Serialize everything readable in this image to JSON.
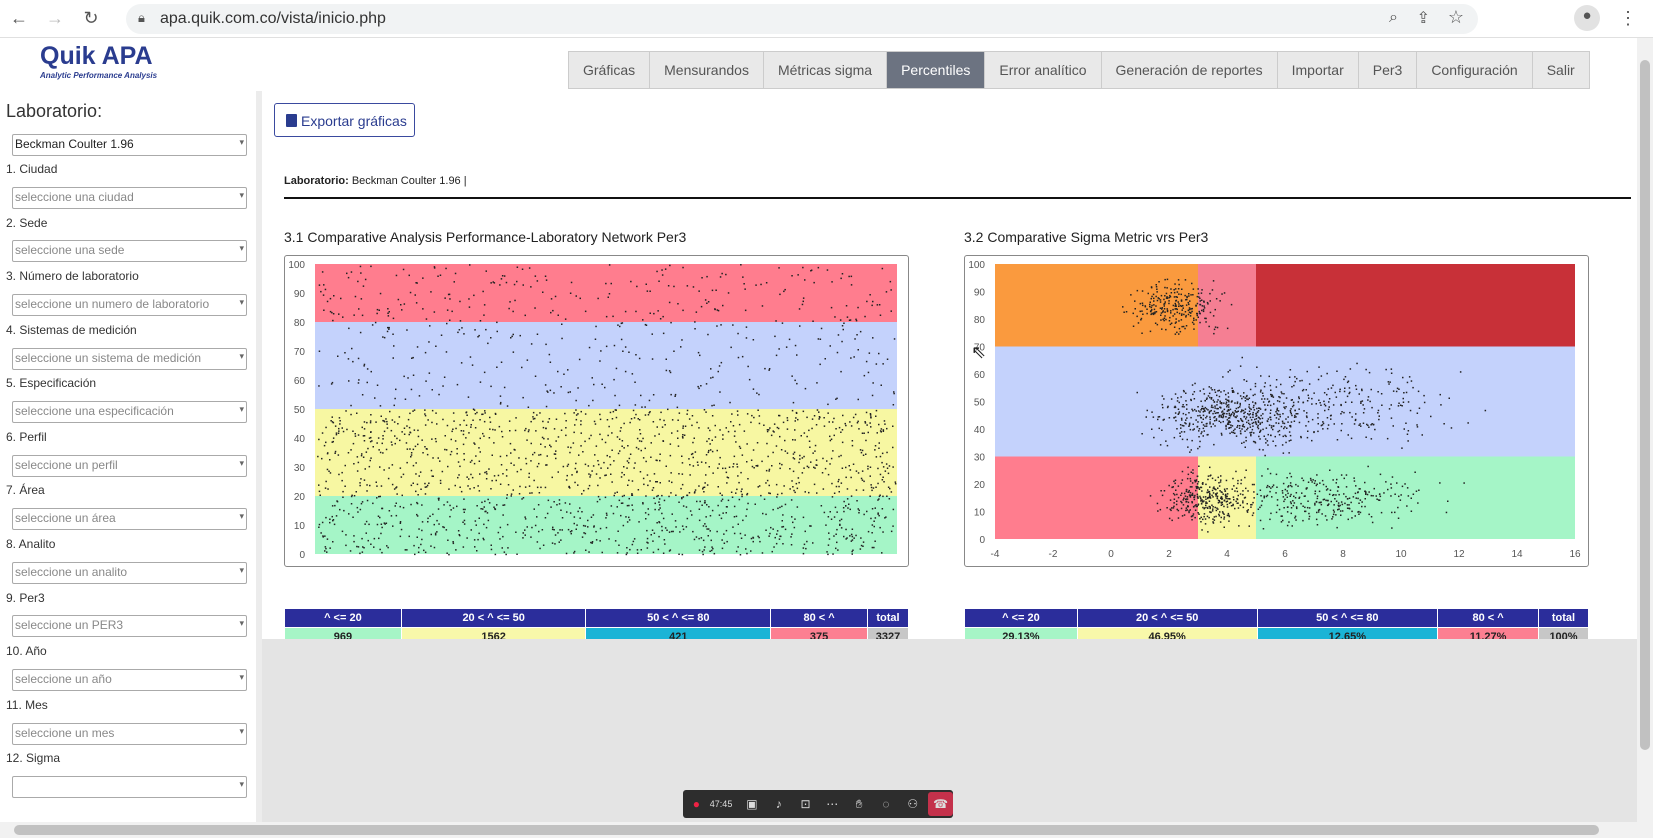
{
  "browser": {
    "url": "apa.quik.com.co/vista/inicio.php"
  },
  "app": {
    "logo": "Quik APA",
    "tagline": "Analytic Performance Analysis"
  },
  "nav": {
    "tabs": [
      "Gráficas",
      "Mensurandos",
      "Métricas sigma",
      "Percentiles",
      "Error analítico",
      "Generación de reportes",
      "Importar",
      "Per3",
      "Configuración",
      "Salir"
    ],
    "active": "Percentiles"
  },
  "sidebar": {
    "title": "Laboratorio:",
    "lab_value": "Beckman Coulter 1.96",
    "filters": [
      {
        "label": "1. Ciudad",
        "placeholder": "seleccione una ciudad"
      },
      {
        "label": "2. Sede",
        "placeholder": "seleccione una sede"
      },
      {
        "label": "3. Número de laboratorio",
        "placeholder": "seleccione un numero de laboratorio"
      },
      {
        "label": "4. Sistemas de medición",
        "placeholder": "seleccione un sistema de medición"
      },
      {
        "label": "5. Especificación",
        "placeholder": "seleccione una especificación"
      },
      {
        "label": "6. Perfil",
        "placeholder": "seleccione un perfil"
      },
      {
        "label": "7. Área",
        "placeholder": "seleccione un área"
      },
      {
        "label": "8. Analito",
        "placeholder": "seleccione un analito"
      },
      {
        "label": "9. Per3",
        "placeholder": "seleccione un PER3"
      },
      {
        "label": "10. Año",
        "placeholder": "seleccione un año"
      },
      {
        "label": "11. Mes",
        "placeholder": "seleccione un mes"
      },
      {
        "label": "12. Sigma",
        "placeholder": ""
      }
    ]
  },
  "main": {
    "export_label": "Exportar gráficas",
    "lab_label": "Laboratorio:",
    "lab_value": "Beckman Coulter 1.96 |",
    "chart1_title": "3.1 Comparative Analysis Performance-Laboratory Network Per3",
    "chart2_title": "3.2 Comparative Sigma Metric vrs Per3"
  },
  "stats_headers": [
    "^ <= 20",
    "20 < ^ <= 50",
    "50 < ^ <= 80",
    "80 < ^",
    "total"
  ],
  "stats1": [
    "969",
    "1562",
    "421",
    "375",
    "3327"
  ],
  "stats2": [
    "29.13%",
    "46.95%",
    "12.65%",
    "11.27%",
    "100%"
  ],
  "stats_colors": [
    "#a6f5c6",
    "#f8f8aa",
    "#1ab4d6",
    "#fc7f91",
    "#c7c7c7"
  ],
  "colors": {
    "band_red": "#ff7d8e",
    "band_blue": "#c4d2fc",
    "band_yellow": "#f7f7a2",
    "band_green": "#a5f5c7",
    "orange": "#fa9a3e",
    "dark_red": "#c83038",
    "pink": "#f57f93"
  },
  "chart_data": [
    {
      "type": "scatter",
      "title": "3.1 Comparative Analysis Performance-Laboratory Network Per3",
      "ylim": [
        0,
        100
      ],
      "yticks": [
        0,
        10,
        20,
        30,
        40,
        50,
        60,
        70,
        80,
        90,
        100
      ],
      "bands": [
        {
          "from": 0,
          "to": 20,
          "color": "#a5f5c7"
        },
        {
          "from": 20,
          "to": 50,
          "color": "#f7f7a2"
        },
        {
          "from": 50,
          "to": 80,
          "color": "#c4d2fc"
        },
        {
          "from": 80,
          "to": 100,
          "color": "#ff7d8e"
        }
      ],
      "counts": {
        "le20": 969,
        "20to50": 1562,
        "50to80": 421,
        "gt80": 375,
        "total": 3327
      }
    },
    {
      "type": "scatter",
      "title": "3.2 Comparative Sigma Metric vrs Per3",
      "xlim": [
        -4,
        16
      ],
      "ylim": [
        0,
        100
      ],
      "xticks": [
        -4,
        -2,
        0,
        2,
        4,
        6,
        8,
        10,
        12,
        14,
        16
      ],
      "yticks": [
        0,
        10,
        20,
        30,
        40,
        50,
        60,
        70,
        80,
        90,
        100
      ],
      "regions": [
        {
          "x": [
            -4,
            16
          ],
          "y": [
            30,
            70
          ],
          "color": "#c4d2fc"
        },
        {
          "x": [
            -4,
            3
          ],
          "y": [
            70,
            100
          ],
          "color": "#fa9a3e"
        },
        {
          "x": [
            3,
            5
          ],
          "y": [
            70,
            100
          ],
          "color": "#f57f93"
        },
        {
          "x": [
            5,
            16
          ],
          "y": [
            70,
            100
          ],
          "color": "#c83038"
        },
        {
          "x": [
            -4,
            3
          ],
          "y": [
            0,
            30
          ],
          "color": "#ff7d8e"
        },
        {
          "x": [
            3,
            5
          ],
          "y": [
            0,
            30
          ],
          "color": "#f7f7a2"
        },
        {
          "x": [
            5,
            16
          ],
          "y": [
            0,
            30
          ],
          "color": "#a5f5c7"
        }
      ],
      "percentages": {
        "le20": "29.13%",
        "20to50": "46.95%",
        "50to80": "12.65%",
        "gt80": "11.27%",
        "total": "100%"
      }
    }
  ],
  "meeting": {
    "time": "47:45"
  }
}
